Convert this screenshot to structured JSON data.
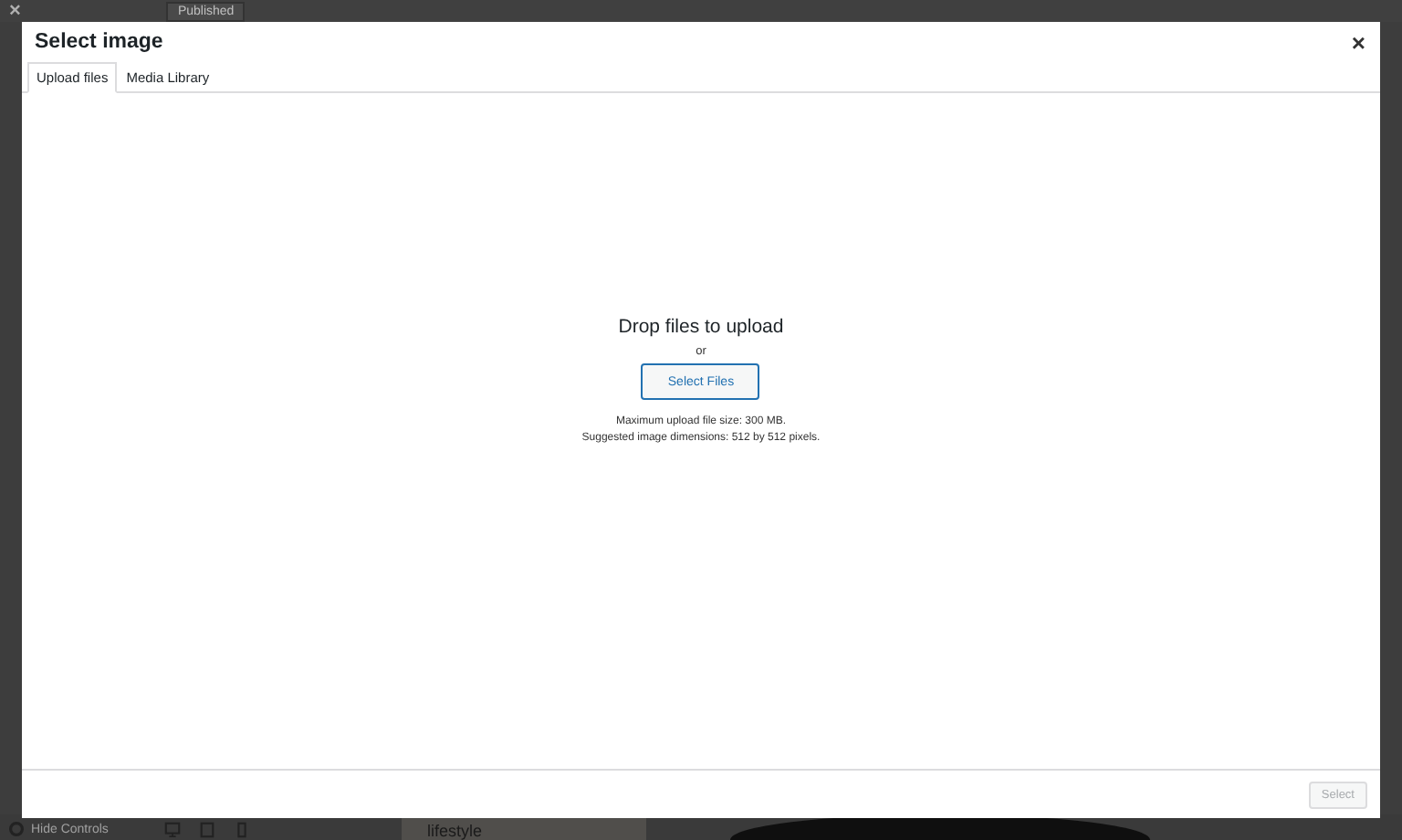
{
  "background": {
    "close_glyph": "×",
    "publish_button": "Published",
    "hide_controls": "Hide Controls",
    "caption": "lifestyle"
  },
  "dialog": {
    "title": "Select image",
    "close_glyph": "×",
    "tabs": [
      {
        "label": "Upload files",
        "selected": true
      },
      {
        "label": "Media Library",
        "selected": false
      }
    ],
    "drop_heading": "Drop files to upload",
    "separator": "or",
    "select_files_button": "Select Files",
    "notes": [
      "Maximum upload file size: 300 MB.",
      "Suggested image dimensions: 512 by 512 pixels."
    ],
    "footer_button": {
      "label": "Select",
      "disabled": true
    }
  }
}
